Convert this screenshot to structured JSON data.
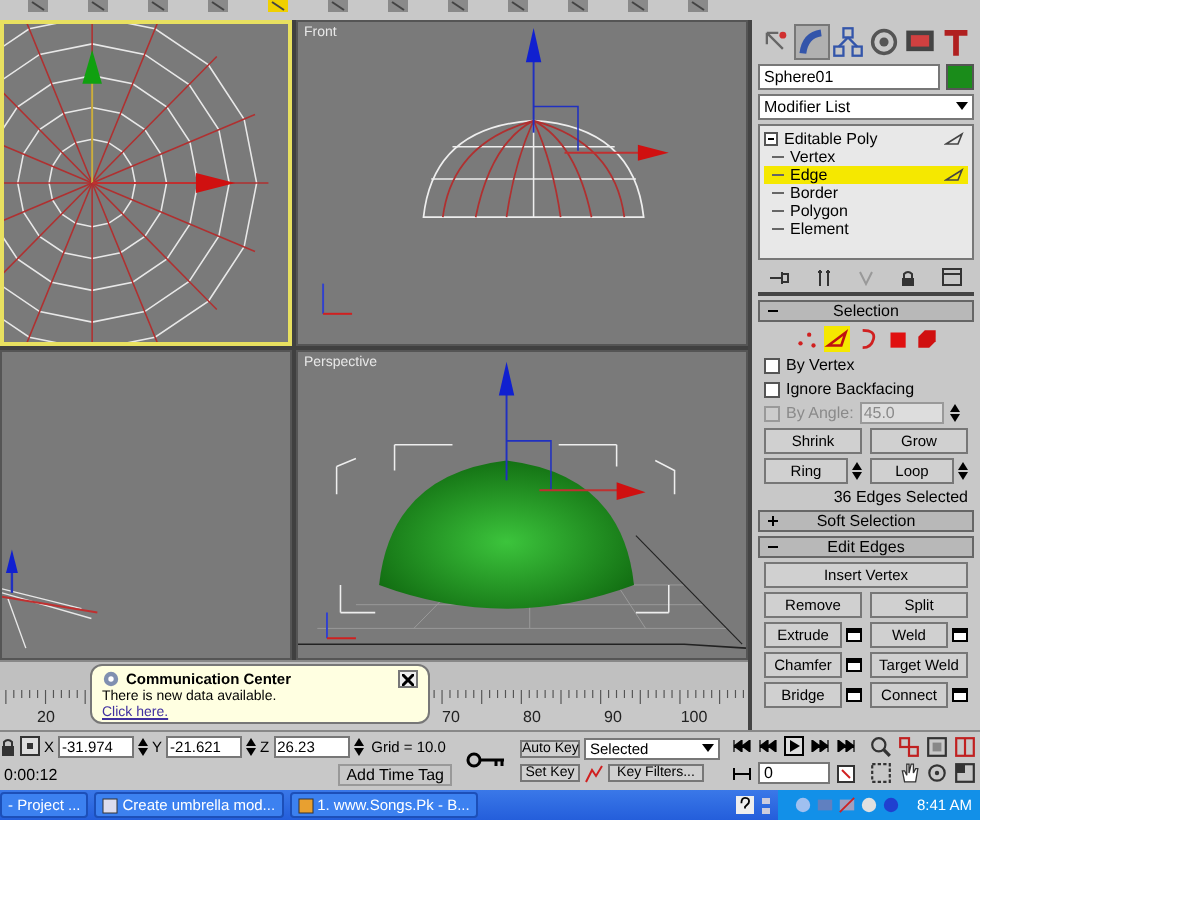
{
  "toolbar": {
    "buttons": [
      {
        "selected": false
      },
      {
        "selected": false
      },
      {
        "selected": false
      },
      {
        "selected": false
      },
      {
        "selected": true
      },
      {
        "selected": false
      },
      {
        "selected": false
      },
      {
        "selected": false
      },
      {
        "selected": false
      },
      {
        "selected": false
      },
      {
        "selected": false
      },
      {
        "selected": false
      }
    ]
  },
  "viewports": [
    {
      "kind": "top",
      "active": true
    },
    {
      "kind": "front",
      "label": "Front",
      "active": false
    },
    {
      "kind": "left",
      "active": false
    },
    {
      "kind": "perspective",
      "label": "Perspective",
      "active": false
    }
  ],
  "command_panel": {
    "tabs": [
      {
        "kind": "create",
        "selected": false
      },
      {
        "kind": "modify",
        "selected": true
      },
      {
        "kind": "hierarchy",
        "selected": false
      },
      {
        "kind": "motion",
        "selected": false
      },
      {
        "kind": "display",
        "selected": false
      },
      {
        "kind": "utilities",
        "selected": false
      }
    ],
    "object_name": "Sphere01",
    "modifier_list": "Modifier List",
    "stack": [
      {
        "label": "Editable Poly",
        "expanded": true,
        "selected": false,
        "children": [
          {
            "label": "Vertex",
            "selected": false
          },
          {
            "label": "Edge",
            "selected": true
          },
          {
            "label": "Border",
            "selected": false
          },
          {
            "label": "Polygon",
            "selected": false
          },
          {
            "label": "Element",
            "selected": false
          }
        ]
      }
    ],
    "rollouts": [
      {
        "title": "Selection",
        "expanded": true,
        "levels": [
          {
            "kind": "vertex",
            "selected": false
          },
          {
            "kind": "edge",
            "selected": true
          },
          {
            "kind": "border",
            "selected": false
          },
          {
            "kind": "polygon",
            "selected": false
          },
          {
            "kind": "element",
            "selected": false
          }
        ],
        "checkboxes": [
          {
            "label": "By Vertex",
            "checked": false,
            "disabled": false
          },
          {
            "label": "Ignore Backfacing",
            "checked": false,
            "disabled": false
          },
          {
            "label": "By Angle:",
            "checked": false,
            "disabled": true,
            "value": "45.0"
          }
        ],
        "button_rows": [
          [
            {
              "label": "Shrink",
              "spinner": false
            },
            {
              "label": "Grow",
              "spinner": false
            }
          ],
          [
            {
              "label": "Ring",
              "spinner": true
            },
            {
              "label": "Loop",
              "spinner": true
            }
          ]
        ],
        "status": "36 Edges Selected"
      },
      {
        "title": "Soft Selection",
        "expanded": false
      },
      {
        "title": "Edit Edges",
        "expanded": true,
        "button_rows": [
          [
            {
              "label": "Insert Vertex",
              "settings": false
            }
          ],
          [
            {
              "label": "Remove",
              "settings": false
            },
            {
              "label": "Split",
              "settings": false
            }
          ],
          [
            {
              "label": "Extrude",
              "settings": true
            },
            {
              "label": "Weld",
              "settings": true
            }
          ],
          [
            {
              "label": "Chamfer",
              "settings": true
            },
            {
              "label": "Target Weld",
              "settings": false
            }
          ],
          [
            {
              "label": "Bridge",
              "settings": true
            },
            {
              "label": "Connect",
              "settings": true
            }
          ]
        ]
      }
    ]
  },
  "timeline": {
    "labels": [
      "20",
      "70",
      "80",
      "90",
      "100"
    ]
  },
  "status_bar": {
    "coordinates": [
      {
        "axis": "X",
        "value": "-31.974"
      },
      {
        "axis": "Y",
        "value": "-21.621"
      },
      {
        "axis": "Z",
        "value": "26.23"
      }
    ],
    "grid": "Grid = 10.0",
    "time": "0:00:12",
    "time_tag": "Add Time Tag"
  },
  "animation": {
    "auto_key": "Auto Key",
    "set_key": "Set Key",
    "key_mode": "Selected",
    "key_filters": "Key Filters...",
    "frame": "0"
  },
  "balloon": {
    "title": "Communication Center",
    "text": "There is new data available.",
    "link": "Click here."
  },
  "taskbar": {
    "items": [
      "- Project ...",
      "Create umbrella mod...",
      "1. www.Songs.Pk - B..."
    ],
    "clock": "8:41 AM"
  }
}
